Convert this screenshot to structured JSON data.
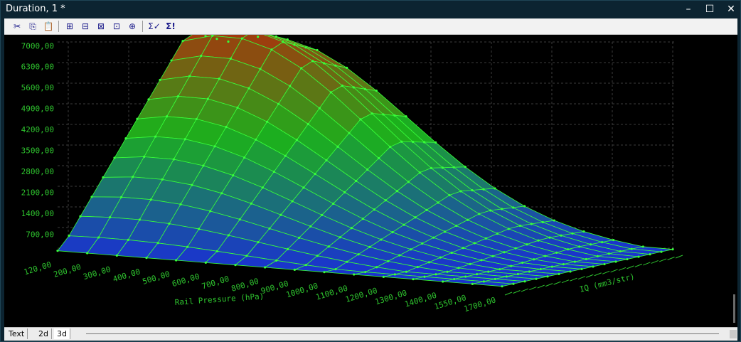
{
  "window": {
    "title": "Duration, 1 *",
    "controls": {
      "minimize": "–",
      "maximize": "☐",
      "close": "✕"
    }
  },
  "toolbar": {
    "icons": [
      {
        "name": "cut-icon",
        "glyph": "✂"
      },
      {
        "name": "copy-icon",
        "glyph": "⎘"
      },
      {
        "name": "paste-icon",
        "glyph": "📋"
      },
      {
        "name": "insert-row-icon",
        "glyph": "⊞"
      },
      {
        "name": "delete-row-icon",
        "glyph": "⊟"
      },
      {
        "name": "insert-col-icon",
        "glyph": "⊠"
      },
      {
        "name": "delete-col-icon",
        "glyph": "⊡"
      },
      {
        "name": "copy-axis-icon",
        "glyph": "⊕"
      },
      {
        "name": "sum-check-icon",
        "glyph": "Σ✓"
      },
      {
        "name": "sum-exclaim-icon",
        "glyph": "Σ!"
      }
    ]
  },
  "tabs": [
    {
      "label": "Text",
      "active": false
    },
    {
      "label": "2d",
      "active": false
    },
    {
      "label": "3d",
      "active": true
    }
  ],
  "chart_data": {
    "type": "surface",
    "xlabel": "Rail Pressure (hPa)",
    "ylabel": "IQ (mm3/str)",
    "x_ticks": [
      "120,00",
      "200,00",
      "300,00",
      "400,00",
      "500,00",
      "600,00",
      "700,00",
      "800,00",
      "900,00",
      "1000,00",
      "1100,00",
      "1200,00",
      "1300,00",
      "1400,00",
      "1550,00",
      "1700,00"
    ],
    "z_ticks": [
      "700,00",
      "1400,00",
      "2100,00",
      "2800,00",
      "3500,00",
      "4200,00",
      "4900,00",
      "5600,00",
      "6300,00",
      "7000,00"
    ],
    "zlim": [
      0,
      7600
    ],
    "colors": {
      "low": "#1a2ed6",
      "mid": "#1cb01c",
      "high": "#c41a0a",
      "wire": "#38ff3a",
      "axis": "#2ec22e",
      "grid": "#3b3b3b"
    }
  }
}
